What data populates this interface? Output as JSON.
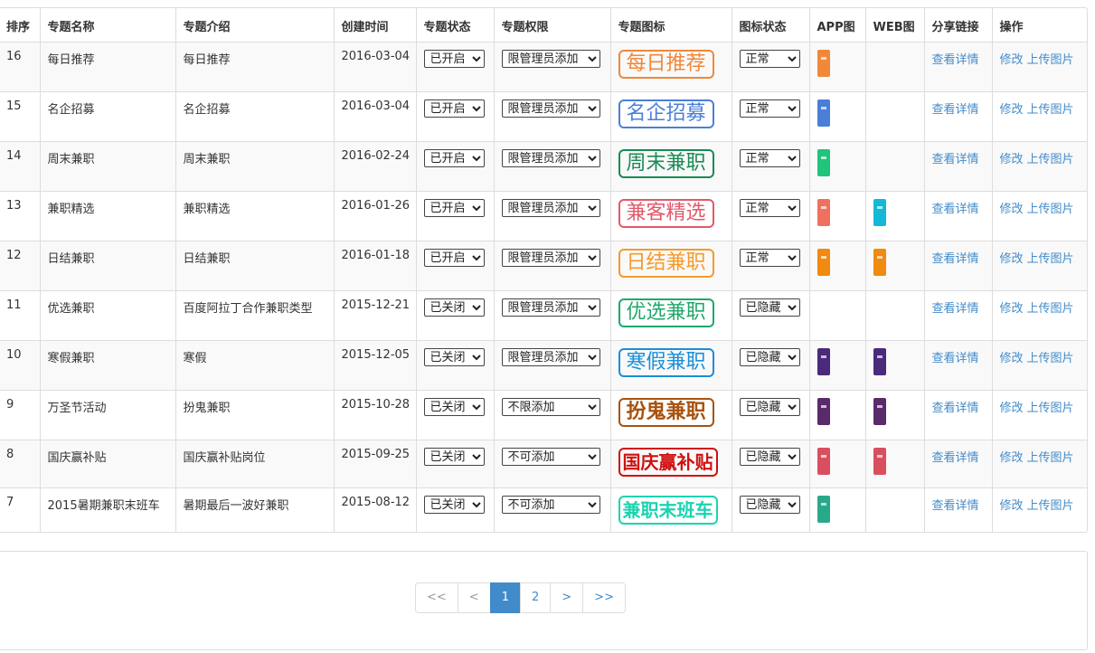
{
  "columns": [
    "排序",
    "专题名称",
    "专题介绍",
    "创建时间",
    "专题状态",
    "专题权限",
    "专题图标",
    "图标状态",
    "APP图",
    "WEB图",
    "分享链接",
    "操作"
  ],
  "actions": {
    "detail": "查看详情",
    "edit": "修改",
    "upload": "上传图片"
  },
  "rows": [
    {
      "order": "16",
      "name": "每日推荐",
      "intro": "每日推荐",
      "date": "2016-03-04",
      "status": "已开启",
      "perm": "限管理员添加",
      "icon_text": "每日推荐",
      "icon_color": "#f0883a",
      "icon_status": "正常",
      "app_color": "#f0883a",
      "web_color": ""
    },
    {
      "order": "15",
      "name": "名企招募",
      "intro": "名企招募",
      "date": "2016-03-04",
      "status": "已开启",
      "perm": "限管理员添加",
      "icon_text": "名企招募",
      "icon_color": "#4a7fd8",
      "icon_status": "正常",
      "app_color": "#4a7fd8",
      "web_color": ""
    },
    {
      "order": "14",
      "name": "周末兼职",
      "intro": "周末兼职",
      "date": "2016-02-24",
      "status": "已开启",
      "perm": "限管理员添加",
      "icon_text": "周末兼职",
      "icon_color": "#1a8a55",
      "icon_status": "正常",
      "app_color": "#22c37a",
      "web_color": ""
    },
    {
      "order": "13",
      "name": "兼职精选",
      "intro": "兼职精选",
      "date": "2016-01-26",
      "status": "已开启",
      "perm": "限管理员添加",
      "icon_text": "兼客精选",
      "icon_color": "#e05a6a",
      "icon_status": "正常",
      "app_color": "#f07060",
      "web_color": "#15b8d6"
    },
    {
      "order": "12",
      "name": "日结兼职",
      "intro": "日结兼职",
      "date": "2016-01-18",
      "status": "已开启",
      "perm": "限管理员添加",
      "icon_text": "日结兼职",
      "icon_color": "#f59a2a",
      "icon_status": "正常",
      "app_color": "#f08a10",
      "web_color": "#f08a10"
    },
    {
      "order": "11",
      "name": "优选兼职",
      "intro": "百度阿拉丁合作兼职类型",
      "date": "2015-12-21",
      "status": "已关闭",
      "perm": "限管理员添加",
      "icon_text": "优选兼职",
      "icon_color": "#1fa86a",
      "icon_status": "已隐藏",
      "app_color": "",
      "web_color": ""
    },
    {
      "order": "10",
      "name": "寒假兼职",
      "intro": "寒假",
      "date": "2015-12-05",
      "status": "已关闭",
      "perm": "限管理员添加",
      "icon_text": "寒假兼职",
      "icon_color": "#1a8fd8",
      "icon_status": "已隐藏",
      "app_color": "#4a2a7a",
      "web_color": "#4a2a7a"
    },
    {
      "order": "9",
      "name": "万圣节活动",
      "intro": "扮鬼兼职",
      "date": "2015-10-28",
      "status": "已关闭",
      "perm": "不限添加",
      "icon_text": "扮鬼兼职",
      "icon_color": "#a8520f",
      "icon_status": "已隐藏",
      "app_color": "#5a2a6a",
      "web_color": "#5a2a6a"
    },
    {
      "order": "8",
      "name": "国庆赢补贴",
      "intro": "国庆赢补贴岗位",
      "date": "2015-09-25",
      "status": "已关闭",
      "perm": "不可添加",
      "icon_text": "国庆赢补贴",
      "icon_color": "#d01010",
      "icon_status": "已隐藏",
      "app_color": "#d85060",
      "web_color": "#d85060"
    },
    {
      "order": "7",
      "name": "2015暑期兼职末班车",
      "intro": "暑期最后一波好兼职",
      "date": "2015-08-12",
      "status": "已关闭",
      "perm": "不可添加",
      "icon_text": "兼职末班车",
      "icon_color": "#19d4b0",
      "icon_status": "已隐藏",
      "app_color": "#2aa88a",
      "web_color": ""
    }
  ],
  "pagination": {
    "first": "<<",
    "prev": "<",
    "pages": [
      "1",
      "2"
    ],
    "current": "1",
    "next": ">",
    "last": ">>"
  }
}
